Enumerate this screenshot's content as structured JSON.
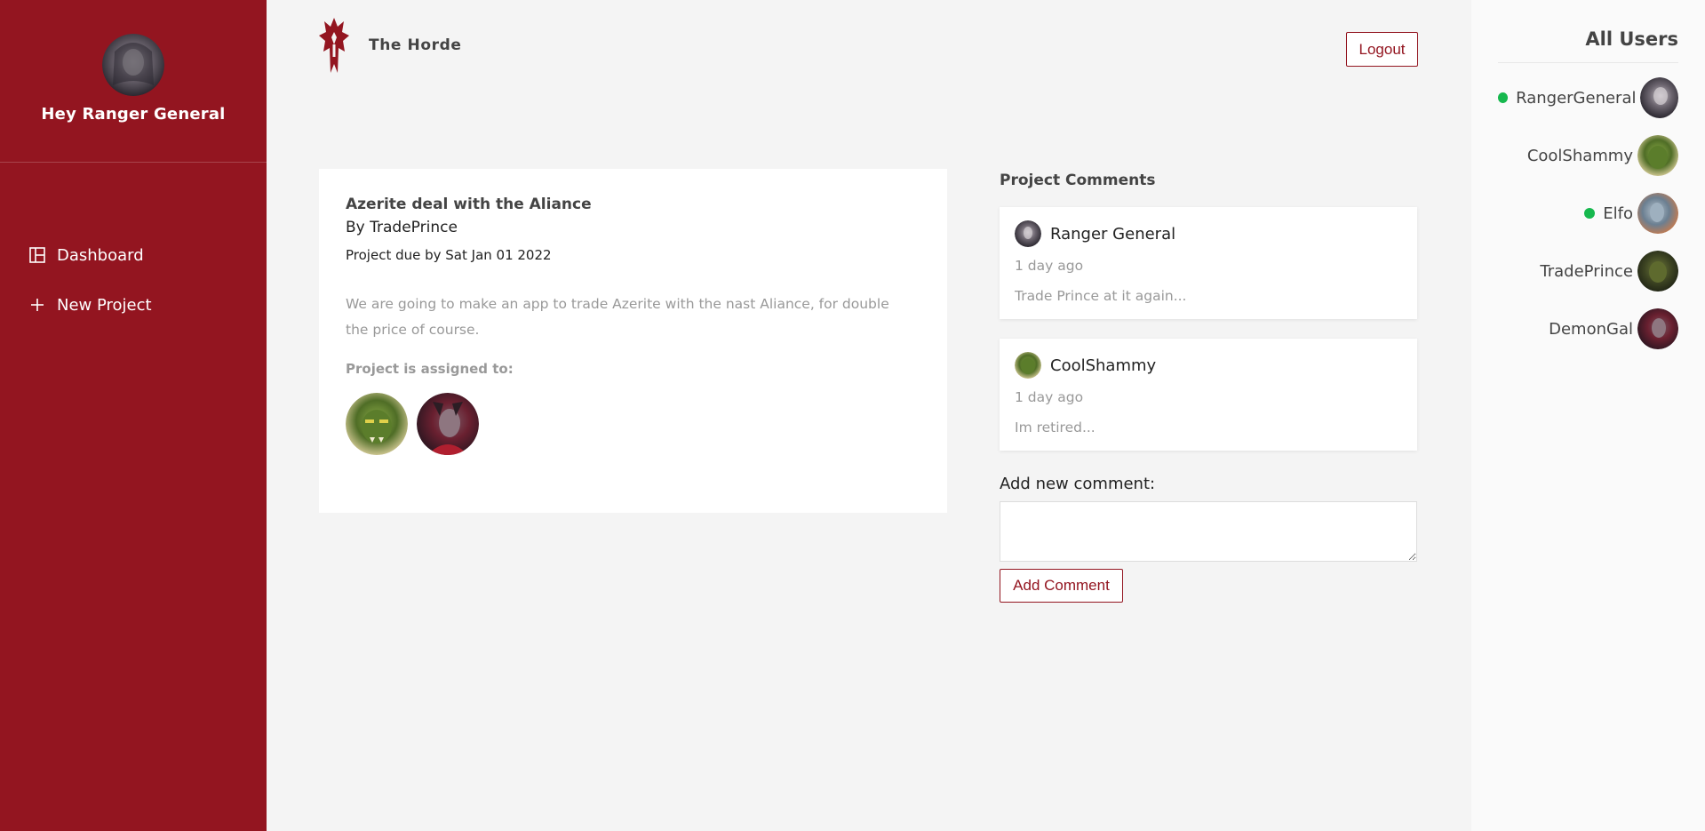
{
  "sidebar": {
    "greeting": "Hey Ranger General",
    "items": [
      {
        "label": "Dashboard",
        "icon": "dashboard-icon"
      },
      {
        "label": "New Project",
        "icon": "plus-icon"
      }
    ]
  },
  "header": {
    "title": "The Horde",
    "logo": "horde-logo",
    "logout_label": "Logout"
  },
  "project": {
    "title": "Azerite deal with the Aliance",
    "by": "By TradePrince",
    "due": "Project due by Sat Jan 01 2022",
    "description": "We are going to make an app to trade Azerite with the nast Aliance, for double the price of course.",
    "assigned_label": "Project is assigned to:"
  },
  "comments": {
    "heading": "Project Comments",
    "items": [
      {
        "author": "Ranger General",
        "time": "1 day ago",
        "text": "Trade Prince at it again..."
      },
      {
        "author": "CoolShammy",
        "time": "1 day ago",
        "text": "Im retired..."
      }
    ],
    "add_label": "Add new comment:",
    "textarea_value": "",
    "add_button": "Add Comment"
  },
  "users": {
    "title": "All Users",
    "list": [
      {
        "name": "RangerGeneral",
        "online": true
      },
      {
        "name": "CoolShammy",
        "online": false
      },
      {
        "name": "Elfo",
        "online": true
      },
      {
        "name": "TradePrince",
        "online": false
      },
      {
        "name": "DemonGal",
        "online": false
      }
    ]
  },
  "colors": {
    "brand": "#931520",
    "online": "#16b84e",
    "background": "#f4f4f4"
  }
}
